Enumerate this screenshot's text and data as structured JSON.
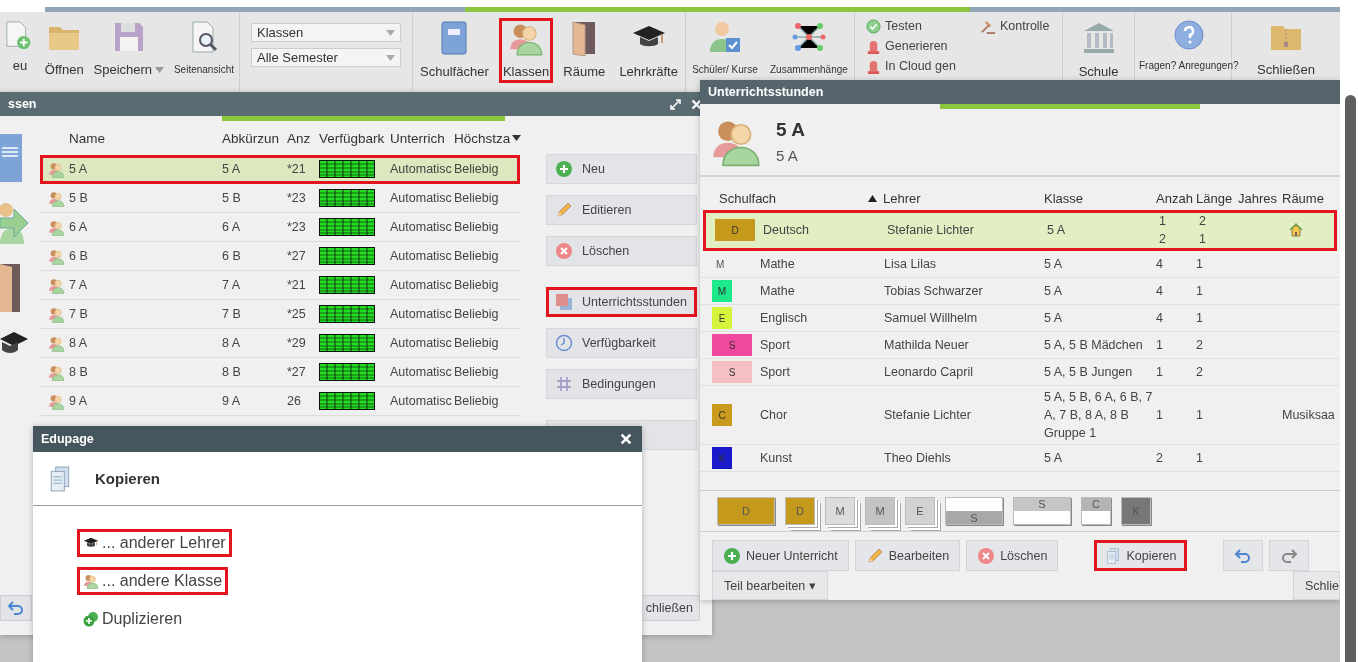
{
  "toolbar": {
    "file_items": [
      {
        "label": "eu",
        "kind": "large",
        "dropdown": false
      },
      {
        "label": "Öffnen",
        "kind": "large",
        "dropdown": false
      },
      {
        "label": "Speichern",
        "kind": "large",
        "dropdown": true
      },
      {
        "label": "Seitenansicht",
        "kind": "small",
        "dropdown": false
      }
    ],
    "selects": [
      {
        "value": "Klassen"
      },
      {
        "value": "Alle Semester"
      }
    ],
    "data_items": [
      {
        "label": "Schulfächer",
        "highlighted": false
      },
      {
        "label": "Klassen",
        "highlighted": true
      },
      {
        "label": "Räume",
        "highlighted": false
      },
      {
        "label": "Lehrkräfte",
        "highlighted": false
      }
    ],
    "view_items": [
      {
        "label": "Schüler/ Kurse"
      },
      {
        "label": "Zusammenhänge"
      }
    ],
    "actions": [
      {
        "label": "Testen"
      },
      {
        "label": "Generieren"
      },
      {
        "label": "In Cloud gen"
      },
      {
        "label": "Kontrolle"
      }
    ],
    "end_items": [
      {
        "label": "Schule",
        "kind": "large"
      },
      {
        "label": "Fragen? Anregungen?",
        "kind": "small"
      },
      {
        "label": "Schließen",
        "kind": "large"
      }
    ]
  },
  "classes_window": {
    "title": "ssen",
    "columns": [
      "Name",
      "Abkürzun",
      "Anz",
      "Verfügbark",
      "Unterrich",
      "Höchstza"
    ],
    "rows": [
      {
        "name": "5 A",
        "abbr": "5 A",
        "count": "*21",
        "lessons": "Automatisc",
        "max": "Beliebig",
        "selected": true,
        "highlighted": true
      },
      {
        "name": "5 B",
        "abbr": "5 B",
        "count": "*23",
        "lessons": "Automatisc",
        "max": "Beliebig",
        "selected": false,
        "highlighted": false
      },
      {
        "name": "6 A",
        "abbr": "6 A",
        "count": "*23",
        "lessons": "Automatisc",
        "max": "Beliebig",
        "selected": false,
        "highlighted": false
      },
      {
        "name": "6 B",
        "abbr": "6 B",
        "count": "*27",
        "lessons": "Automatisc",
        "max": "Beliebig",
        "selected": false,
        "highlighted": false
      },
      {
        "name": "7 A",
        "abbr": "7 A",
        "count": "*21",
        "lessons": "Automatisc",
        "max": "Beliebig",
        "selected": false,
        "highlighted": false
      },
      {
        "name": "7 B",
        "abbr": "7 B",
        "count": "*25",
        "lessons": "Automatisc",
        "max": "Beliebig",
        "selected": false,
        "highlighted": false
      },
      {
        "name": "8 A",
        "abbr": "8 A",
        "count": "*29",
        "lessons": "Automatisc",
        "max": "Beliebig",
        "selected": false,
        "highlighted": false
      },
      {
        "name": "8 B",
        "abbr": "8 B",
        "count": "*27",
        "lessons": "Automatisc",
        "max": "Beliebig",
        "selected": false,
        "highlighted": false
      },
      {
        "name": "9 A",
        "abbr": "9 A",
        "count": "26",
        "lessons": "Automatisc",
        "max": "Beliebig",
        "selected": false,
        "highlighted": false
      }
    ],
    "buttons": [
      {
        "label": "Neu",
        "highlighted": false
      },
      {
        "label": "Editieren",
        "highlighted": false
      },
      {
        "label": "Löschen",
        "highlighted": false
      },
      {
        "label": "Unterrichtsstunden",
        "highlighted": true
      },
      {
        "label": "Verfügbarkeit",
        "highlighted": false
      },
      {
        "label": "Bedingungen",
        "highlighted": false
      }
    ],
    "footer_button": "chließen"
  },
  "lessons_window": {
    "title": "Unterrichtsstunden",
    "class_name": "5 A",
    "class_short": "5 A",
    "columns": [
      {
        "label": "Schulfach",
        "sorted": false
      },
      {
        "label": "Lehrer",
        "sorted": true
      },
      {
        "label": "Klasse",
        "sorted": false
      },
      {
        "label": "Anzah",
        "sorted": false
      },
      {
        "label": "Länge",
        "sorted": false
      },
      {
        "label": "Jahres",
        "sorted": false
      },
      {
        "label": "Räume",
        "sorted": false
      }
    ],
    "rows": [
      {
        "code": "D",
        "color": "#c4991c",
        "kind": "double",
        "subject": "Deutsch",
        "teacher": "Stefanie Lichter",
        "classes": "5 A",
        "count": "1\n2",
        "length": "2\n1",
        "room_icon": true,
        "selected": true,
        "highlighted": true
      },
      {
        "code": "M",
        "kind": "plain",
        "subject": "Mathe",
        "teacher": "Lisa Lilas",
        "classes": "5 A",
        "count": "4",
        "length": "1",
        "room_icon": false,
        "selected": false,
        "highlighted": false
      },
      {
        "code": "M",
        "color": "#1de98b",
        "kind": "single",
        "subject": "Mathe",
        "teacher": "Tobias Schwarzer",
        "classes": "5 A",
        "count": "4",
        "length": "1",
        "room_icon": false,
        "selected": false,
        "highlighted": false
      },
      {
        "code": "E",
        "color": "#d4f53c",
        "kind": "single",
        "subject": "Englisch",
        "teacher": "Samuel Willhelm",
        "classes": "5 A",
        "count": "4",
        "length": "1",
        "room_icon": false,
        "selected": false,
        "highlighted": false
      },
      {
        "code": "S",
        "color": "#f0479f",
        "kind": "double",
        "subject": "Sport",
        "teacher": "Mathilda Neuer",
        "classes": "5 A, 5 B Mädchen",
        "count": "1",
        "length": "2",
        "room_icon": false,
        "selected": false,
        "highlighted": false
      },
      {
        "code": "S",
        "color": "#f4c0c4",
        "kind": "double",
        "subject": "Sport",
        "teacher": "Leonardo Capril",
        "classes": "5 A, 5 B Jungen",
        "count": "1",
        "length": "2",
        "room_icon": false,
        "selected": false,
        "highlighted": false
      },
      {
        "code": "C",
        "color": "#c99a1b",
        "kind": "single",
        "subject": "Chor",
        "teacher": "Stefanie Lichter",
        "classes": "5 A, 5 B, 6 A, 6 B, 7 A, 7 B, 8 A, 8 B Gruppe 1",
        "count": "1",
        "length": "1",
        "room_icon": false,
        "rooms": "Musiksaa",
        "selected": false,
        "highlighted": false
      },
      {
        "code": "K",
        "color": "#1a1acc",
        "kind": "single",
        "subject": "Kunst",
        "teacher": "Theo Diehls",
        "classes": "5 A",
        "count": "2",
        "length": "1",
        "room_icon": false,
        "selected": false,
        "highlighted": false
      }
    ],
    "chips": [
      {
        "label": "D",
        "color": "#c4991c",
        "kind": "solid",
        "wide": true
      },
      {
        "label": "D",
        "color": "#c4991c",
        "kind": "stacked",
        "wide": false
      },
      {
        "label": "M",
        "color": "#dcdcdc",
        "kind": "stacked",
        "wide": false
      },
      {
        "label": "M",
        "color": "#c4c4c4",
        "kind": "stacked",
        "wide": false
      },
      {
        "label": "E",
        "color": "#d2d2d2",
        "kind": "stacked",
        "wide": false
      },
      {
        "label": "S",
        "color": "#a8a8a8",
        "kind": "lower",
        "wide": true
      },
      {
        "label": "S",
        "color": "#c6c6c6",
        "kind": "upper",
        "wide": true
      },
      {
        "label": "C",
        "color": "#b4b4b4",
        "kind": "upper",
        "wide": false
      },
      {
        "label": "K",
        "color": "#777777",
        "kind": "solid",
        "wide": false
      }
    ],
    "buttons": [
      {
        "label": "Neuer Unterricht",
        "highlighted": false
      },
      {
        "label": "Bearbeiten",
        "highlighted": false
      },
      {
        "label": "Löschen",
        "highlighted": false
      },
      {
        "label": "Kopieren",
        "highlighted": true
      }
    ],
    "part_menu": "Teil bearbeiten ▾",
    "close_button": "Schlie"
  },
  "dialog": {
    "title": "Edupage",
    "heading": "Kopieren",
    "options": [
      {
        "label": "... anderer Lehrer",
        "highlighted": true
      },
      {
        "label": "... andere Klasse",
        "highlighted": true
      },
      {
        "label": "Duplizieren",
        "highlighted": false
      }
    ]
  }
}
